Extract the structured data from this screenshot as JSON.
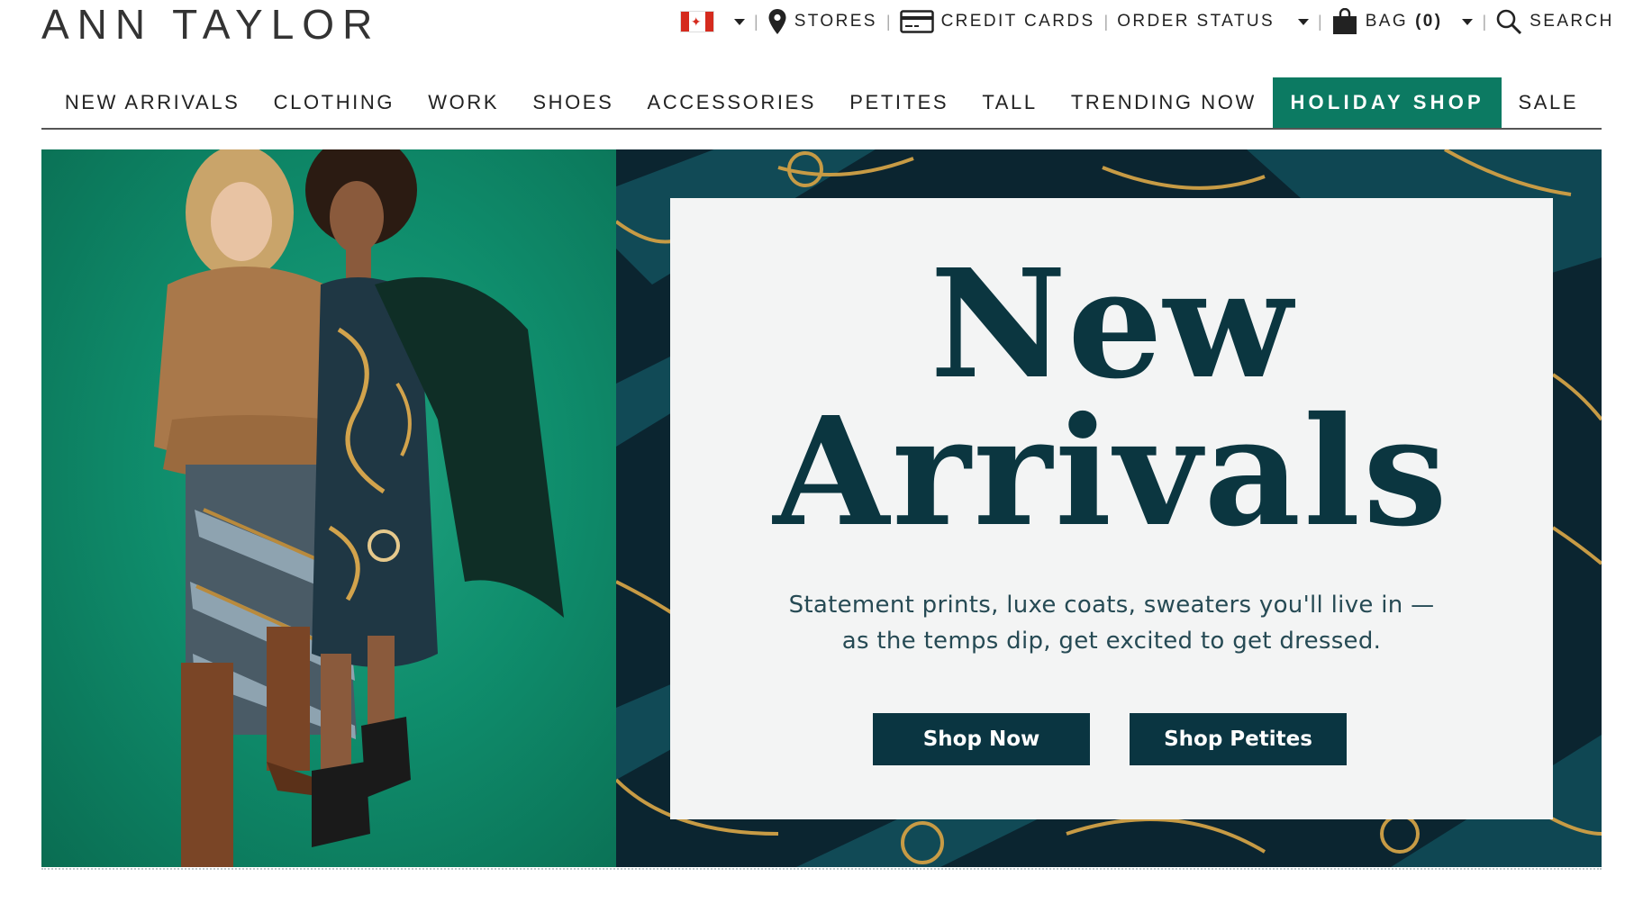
{
  "brand": {
    "logo_text": "ANN TAYLOR"
  },
  "utility_nav": {
    "country_icon": "canada-flag-icon",
    "stores_label": "STORES",
    "credit_cards_label": "CREDIT CARDS",
    "order_status_label": "ORDER STATUS",
    "bag_label": "BAG",
    "bag_count": "(0)",
    "search_label": "SEARCH"
  },
  "main_nav": {
    "items": [
      {
        "label": "NEW ARRIVALS"
      },
      {
        "label": "CLOTHING"
      },
      {
        "label": "WORK"
      },
      {
        "label": "SHOES"
      },
      {
        "label": "ACCESSORIES"
      },
      {
        "label": "PETITES"
      },
      {
        "label": "TALL"
      },
      {
        "label": "TRENDING NOW"
      },
      {
        "label": "HOLIDAY SHOP"
      },
      {
        "label": "SALE"
      }
    ],
    "highlight_color": "#0c7a62"
  },
  "hero": {
    "headline_line1": "New",
    "headline_line2": "Arrivals",
    "subtext_line1": "Statement prints, luxe coats, sweaters you'll live in —",
    "subtext_line2": "as the temps dip, get excited to get dressed.",
    "primary_button": "Shop Now",
    "secondary_button": "Shop Petites",
    "accent_color": "#0b3640",
    "photo_background": "#0f8d6c"
  }
}
